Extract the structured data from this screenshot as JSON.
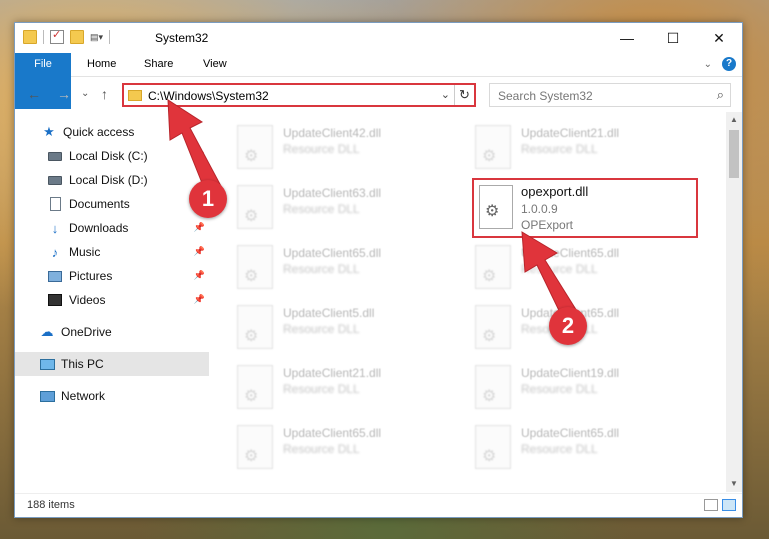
{
  "window": {
    "title": "System32",
    "controls": {
      "minimize": "—",
      "maximize": "☐",
      "close": "✕"
    }
  },
  "ribbon": {
    "tabs": [
      {
        "label": "File"
      },
      {
        "label": "Home"
      },
      {
        "label": "Share"
      },
      {
        "label": "View"
      }
    ],
    "help": "?"
  },
  "nav": {
    "back": "←",
    "forward": "→",
    "recent": "⌄",
    "up": "↑"
  },
  "address": {
    "path": "C:\\Windows\\System32",
    "dropdown": "⌄",
    "refresh": "↻"
  },
  "search": {
    "placeholder": "Search System32",
    "icon": "⌕"
  },
  "sidebar": {
    "items": [
      {
        "label": "Quick access",
        "icon": "star-icon",
        "pinned": false
      },
      {
        "label": "Local Disk (C:)",
        "icon": "drive-icon",
        "pinned": true
      },
      {
        "label": "Local Disk (D:)",
        "icon": "drive-icon",
        "pinned": false
      },
      {
        "label": "Documents",
        "icon": "document-icon",
        "pinned": true
      },
      {
        "label": "Downloads",
        "icon": "download-icon",
        "pinned": true
      },
      {
        "label": "Music",
        "icon": "music-icon",
        "pinned": true
      },
      {
        "label": "Pictures",
        "icon": "pictures-icon",
        "pinned": true
      },
      {
        "label": "Videos",
        "icon": "videos-icon",
        "pinned": true
      },
      {
        "label": "OneDrive",
        "icon": "cloud-icon",
        "pinned": false
      },
      {
        "label": "This PC",
        "icon": "computer-icon",
        "pinned": false,
        "selected": true
      },
      {
        "label": "Network",
        "icon": "network-icon",
        "pinned": false
      }
    ]
  },
  "files": [
    {
      "name": "UpdateClient42.dll",
      "type": "Resource DLL"
    },
    {
      "name": "UpdateClient21.dll",
      "type": "Resource DLL"
    },
    {
      "name": "UpdateClient63.dll",
      "type": "Resource DLL"
    },
    {
      "name": "UpdateClient65.dll",
      "type": "Resource DLL"
    },
    {
      "name": "UpdateClient65.dll",
      "type": "Resource DLL"
    },
    {
      "name": "UpdateClient5.dll",
      "type": "Resource DLL"
    },
    {
      "name": "UpdateClient65.dll",
      "type": "Resource DLL"
    },
    {
      "name": "UpdateClient21.dll",
      "type": "Resource DLL"
    },
    {
      "name": "UpdateClient19.dll",
      "type": "Resource DLL"
    },
    {
      "name": "UpdateClient65.dll",
      "type": "Resource DLL"
    },
    {
      "name": "UpdateClient65.dll",
      "type": "Resource DLL"
    }
  ],
  "featured_file": {
    "name": "opexport.dll",
    "version": "1.0.0.9",
    "description": "OPExport"
  },
  "status": {
    "item_count": "188 items"
  },
  "annotations": [
    {
      "number": "1"
    },
    {
      "number": "2"
    }
  ],
  "colors": {
    "accent": "#1979ca",
    "highlight_red": "#d9363e"
  }
}
